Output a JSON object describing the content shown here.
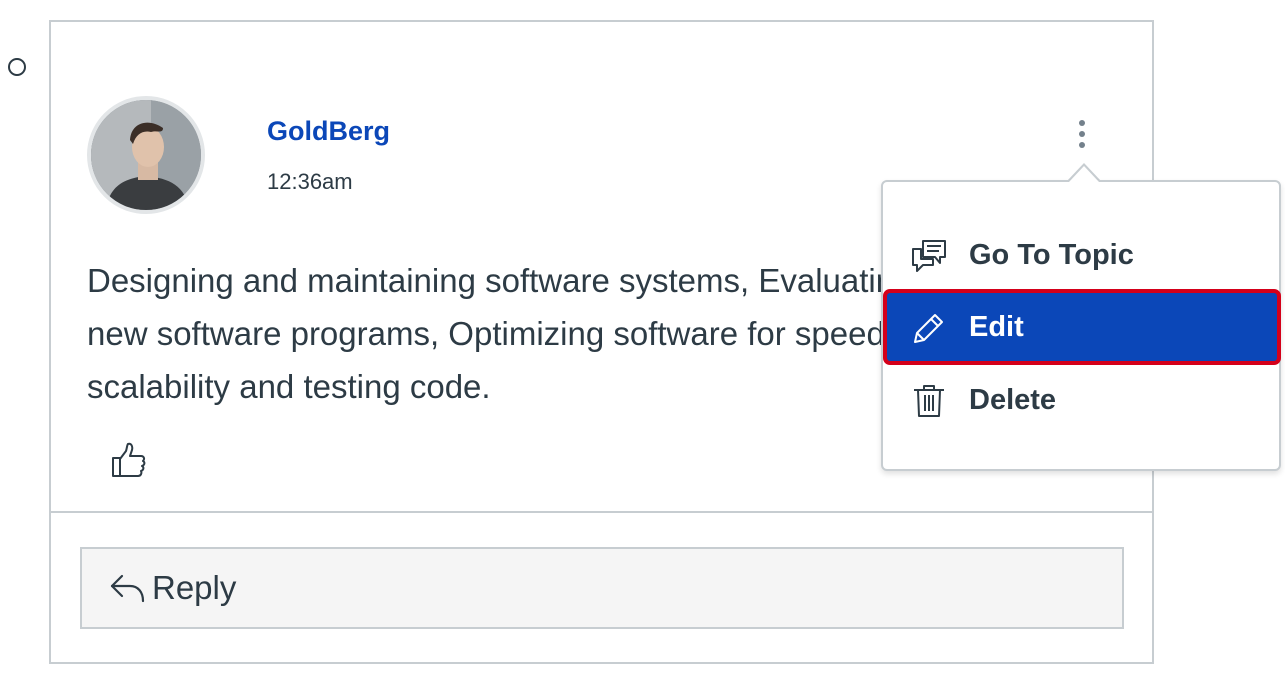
{
  "post": {
    "author": "GoldBerg",
    "timestamp": "12:36am",
    "message": "Designing and maintaining software systems, Evaluating and testing new software programs, Optimizing software for speed and scalability and testing code.",
    "reply_label": "Reply"
  },
  "menu": {
    "items": [
      {
        "label": "Go To Topic",
        "icon": "discussion-icon"
      },
      {
        "label": "Edit",
        "icon": "pencil-icon",
        "state": "highlighted"
      },
      {
        "label": "Delete",
        "icon": "trash-icon"
      }
    ]
  },
  "colors": {
    "accent": "#0b47b8",
    "highlight_border": "#d4001a",
    "text": "#2d3b45",
    "border": "#c7cdd1"
  }
}
